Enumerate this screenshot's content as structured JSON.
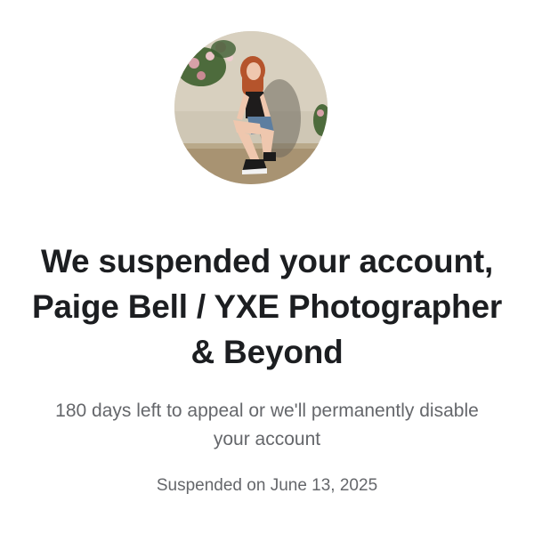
{
  "profile": {
    "avatar_icon": "profile-photo"
  },
  "notice": {
    "title": "We suspended your account, Paige Bell / YXE Photographer & Beyond",
    "appeal_text": "180 days left to appeal or we'll permanently disable your account",
    "suspended_date": "Suspended on June 13, 2025"
  },
  "colors": {
    "title": "#1c1e21",
    "secondary_text": "#65676b",
    "background": "#ffffff"
  }
}
